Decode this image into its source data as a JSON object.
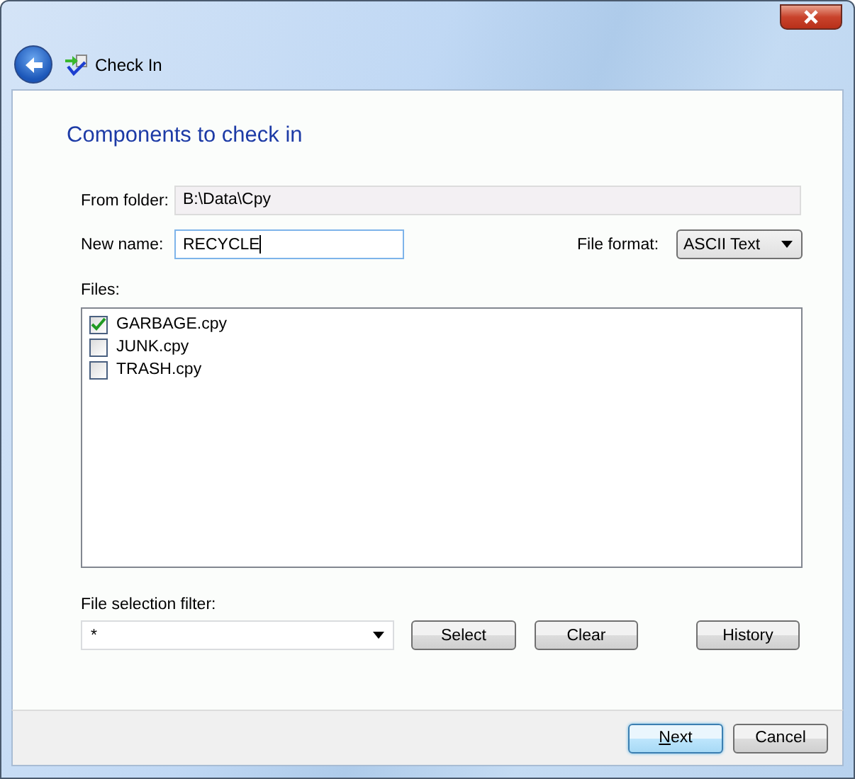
{
  "window": {
    "title": "Check In"
  },
  "heading": "Components to check in",
  "from_folder": {
    "label": "From folder:",
    "value": "B:\\Data\\Cpy",
    "disabled": true
  },
  "new_name": {
    "label": "New name:",
    "value": "RECYCLE",
    "focused": true
  },
  "file_format": {
    "label": "File format:",
    "value": "ASCII Text"
  },
  "files": {
    "label": "Files:",
    "items": [
      {
        "name": "GARBAGE.cpy",
        "checked": true
      },
      {
        "name": "JUNK.cpy",
        "checked": false
      },
      {
        "name": "TRASH.cpy",
        "checked": false
      }
    ]
  },
  "filter": {
    "label": "File selection filter:",
    "value": "*"
  },
  "filter_buttons": [
    "Select",
    "Clear",
    "History"
  ],
  "footer_buttons": [
    {
      "label": "Next",
      "default": true,
      "first_letter_underlined": true
    },
    {
      "label": "Cancel",
      "default": false
    }
  ]
}
